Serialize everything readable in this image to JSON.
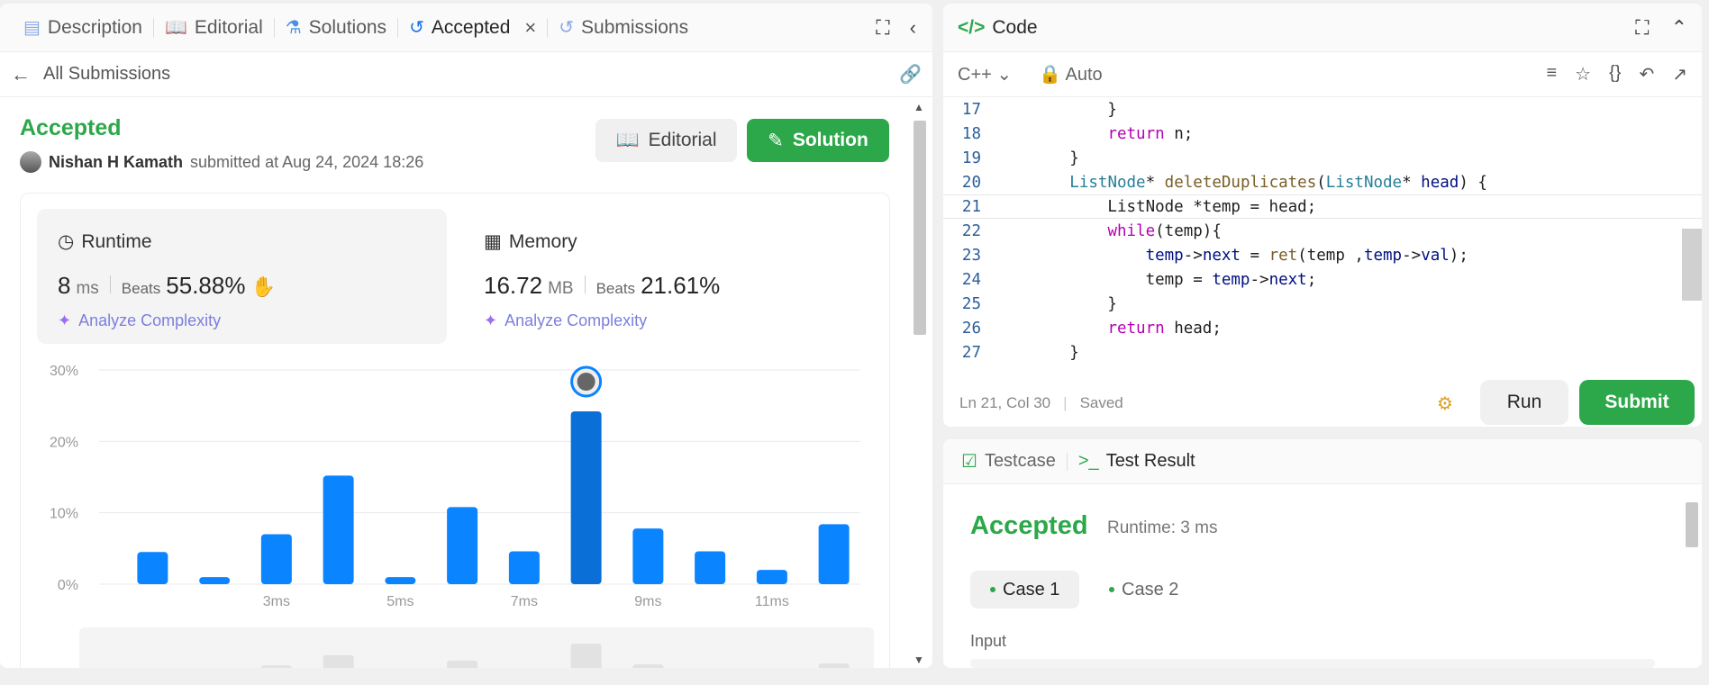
{
  "left": {
    "tabs": [
      {
        "label": "Description",
        "icon": "document-icon"
      },
      {
        "label": "Editorial",
        "icon": "book-icon"
      },
      {
        "label": "Solutions",
        "icon": "flask-icon"
      },
      {
        "label": "Accepted",
        "icon": "history-icon"
      },
      {
        "label": "Submissions",
        "icon": "history-icon"
      }
    ],
    "all_submissions": "All Submissions",
    "status": "Accepted",
    "author": "Nishan H Kamath",
    "submitted_text": "submitted at Aug 24, 2024 18:26",
    "editorial_btn": "Editorial",
    "solution_btn": "Solution",
    "runtime": {
      "title": "Runtime",
      "value": "8",
      "unit": "ms",
      "beats_label": "Beats",
      "beats": "55.88%",
      "analyze": "Analyze Complexity"
    },
    "memory": {
      "title": "Memory",
      "value": "16.72",
      "unit": "MB",
      "beats_label": "Beats",
      "beats": "21.61%",
      "analyze": "Analyze Complexity"
    }
  },
  "chart_data": {
    "type": "bar",
    "y_ticks": [
      "30%",
      "20%",
      "10%",
      "0%"
    ],
    "ylim": [
      0,
      30
    ],
    "x_ticks": [
      "3ms",
      "5ms",
      "7ms",
      "9ms",
      "11ms"
    ],
    "values": [
      4.5,
      1,
      7,
      15.2,
      1,
      10.8,
      4.6,
      24.2,
      7.8,
      4.6,
      2,
      8.4
    ],
    "highlight_index": 7,
    "bar_color": "#0a84ff",
    "highlight_color": "#0a6fd6"
  },
  "code": {
    "title": "Code",
    "language": "C++",
    "mode": "Auto",
    "lines": [
      {
        "n": "17",
        "html": "            }"
      },
      {
        "n": "18",
        "html": "            <span class='kw'>return</span> n;"
      },
      {
        "n": "19",
        "html": "        }"
      },
      {
        "n": "20",
        "html": "        <span class='ty'>ListNode</span>* <span class='fn'>deleteDuplicates</span>(<span class='ty'>ListNode</span>* <span class='vr'>head</span>) {"
      },
      {
        "n": "21",
        "html": "            ListNode *temp = head;"
      },
      {
        "n": "22",
        "html": "            <span class='kw'>while</span>(temp){"
      },
      {
        "n": "23",
        "html": "                <span class='vr'>temp</span>-&gt;<span class='vr'>next</span> = <span class='fn'>ret</span>(temp ,<span class='vr'>temp</span>-&gt;<span class='vr'>val</span>);"
      },
      {
        "n": "24",
        "html": "                temp = <span class='vr'>temp</span>-&gt;<span class='vr'>next</span>;"
      },
      {
        "n": "25",
        "html": "            }"
      },
      {
        "n": "26",
        "html": "            <span class='kw'>return</span> head;"
      },
      {
        "n": "27",
        "html": "        }"
      }
    ],
    "cursor_line": "21",
    "status_pos": "Ln 21, Col 30",
    "status_saved": "Saved",
    "run": "Run",
    "submit": "Submit"
  },
  "bottom": {
    "testcase_tab": "Testcase",
    "result_tab": "Test Result",
    "status": "Accepted",
    "runtime": "Runtime: 3 ms",
    "case1": "Case 1",
    "case2": "Case 2",
    "input_label": "Input"
  }
}
